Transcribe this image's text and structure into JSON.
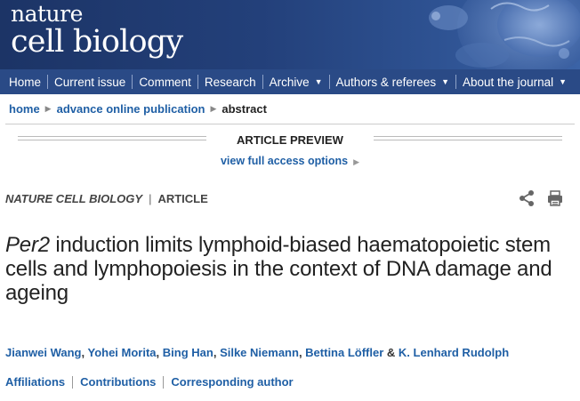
{
  "header": {
    "logo_line1": "nature",
    "logo_line2": "cell biology"
  },
  "nav": {
    "items": [
      {
        "label": "Home",
        "dropdown": false
      },
      {
        "label": "Current issue",
        "dropdown": false
      },
      {
        "label": "Comment",
        "dropdown": false
      },
      {
        "label": "Research",
        "dropdown": false
      },
      {
        "label": "Archive",
        "dropdown": true
      },
      {
        "label": "Authors & referees",
        "dropdown": true
      },
      {
        "label": "About the journal",
        "dropdown": true
      }
    ],
    "caret": "▼"
  },
  "breadcrumb": {
    "home": "home",
    "section": "advance online publication",
    "current": "abstract",
    "arrow": "▶"
  },
  "preview": {
    "title": "ARTICLE PREVIEW",
    "access_link": "view full access options",
    "arrow": "▶"
  },
  "journal": {
    "name": "NATURE CELL BIOLOGY",
    "separator": "|",
    "type": "ARTICLE"
  },
  "article": {
    "title_gene": "Per2",
    "title_rest": " induction limits lymphoid-biased haematopoietic stem cells and lymphopoiesis in the context of DNA damage and ageing"
  },
  "authors": {
    "list": [
      "Jianwei Wang",
      "Yohei Morita",
      "Bing Han",
      "Silke Niemann",
      "Bettina Löffler",
      "K. Lenhard Rudolph"
    ],
    "separator": ", ",
    "last_separator": " & "
  },
  "info_links": [
    "Affiliations",
    "Contributions",
    "Corresponding author"
  ],
  "icons": {
    "share": "share-icon",
    "print": "print-icon"
  },
  "colors": {
    "banner": "#23407a",
    "navbar": "#2a4a86",
    "link": "#1f5fa5"
  }
}
